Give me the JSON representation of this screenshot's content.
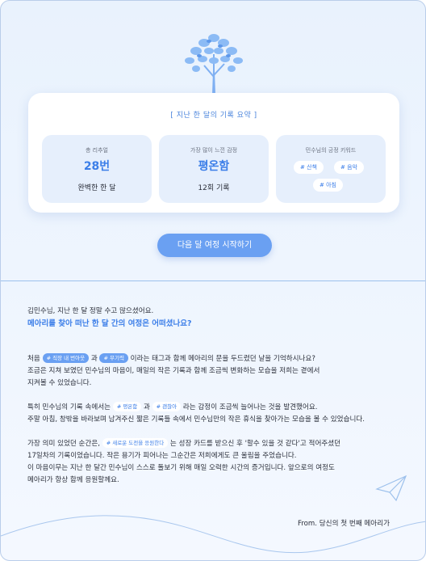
{
  "summary": {
    "title": "[ 지난 한 달의 기록 요약 ]",
    "stats": [
      {
        "label": "총 리추얼",
        "value": "28번",
        "sub": "완벽한 한 달"
      },
      {
        "label": "가장 많이 느낀 감정",
        "value": "평온함",
        "sub": "12회 기록"
      },
      {
        "label": "민수님의 긍정 키워드",
        "keywords": [
          "# 산책",
          "# 음악",
          "# 아침"
        ]
      }
    ]
  },
  "cta_label": "다음 달 여정 시작하기",
  "letter": {
    "greeting": "김민수님, 지난 한 달 정말 수고 많으셨어요.",
    "headline": "메아리를 찾아 떠난 한 달 간의 여정은 어떠셨나요?",
    "p1": {
      "prefix": "처음",
      "tag1": "# 직장 내 번아웃",
      "and": "과",
      "tag2": "# 무기력",
      "rest": "이라는 태그과 함께 메아리의 문을 두드렸던 날을 기억하시나요?",
      "line2": "조금은 지쳐 보였던 민수님의 마음이, 매일의 작은 기록과 함께 조금씩 변화하는 모습을 저희는 곁에서",
      "line3": "지켜볼 수 있었습니다."
    },
    "p2": {
      "prefix": "특히 민수님의 기록 속에서는",
      "tag1": "# 평온함",
      "and": "과",
      "tag2": "# 괜찮아",
      "rest": "라는 감정이 조금씩 늘어나는 것을 발견했어요.",
      "line2": "주말 아침, 창밖을 바라보며 남겨주신 짧은 기록들 속에서 민수님만의 작은 휴식을 찾아가는 모습을 볼 수 있었습니다."
    },
    "p3": {
      "prefix": "가장 의미 있었던 순간은,",
      "tag1": "# 새로운 도전을 응원한다",
      "rest": "는 성장 카드를 받으신 후 '할수 있을 것 같다'고 적어주셨던",
      "line2": "17일차의 기록이었습니다. 작은 용기가 피어나는 그순간은 저희에게도 큰 울림을 주었습니다.",
      "line3": "이 마음이무는 지난 한 달간 민수님이 스스로 돌보기 위해 매일 오력한 시간의 증거입니다. 앞으로의 여정도",
      "line4": "메아리가 항상 함께 응원할께요."
    },
    "signature": "From.  당신의 첫 번째 메아리가"
  },
  "colors": {
    "accent": "#3b7ee8",
    "button": "#6aa0f2",
    "card_bg": "#e6effc",
    "page_bg": "#eef5fe"
  },
  "icons": [
    "tree-icon",
    "paper-plane-icon"
  ]
}
